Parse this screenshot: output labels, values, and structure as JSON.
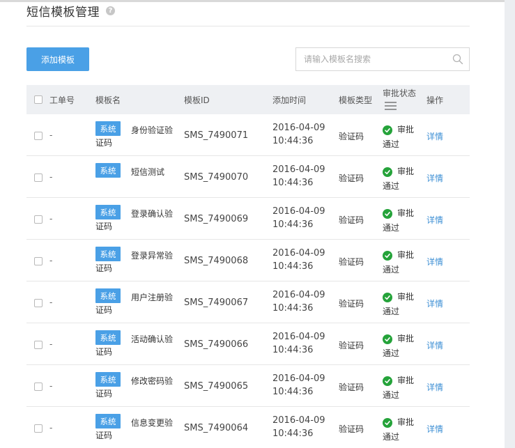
{
  "page": {
    "title": "短信模板管理",
    "help_icon": "question-circle-icon"
  },
  "toolbar": {
    "add_label": "添加模板",
    "search_placeholder": "请输入模板名搜索",
    "search_icon": "search-icon"
  },
  "table": {
    "headers": {
      "order_no": "工单号",
      "name": "模板名",
      "id": "模板ID",
      "added_time": "添加时间",
      "type": "模板类型",
      "status": "审批状态",
      "status_filter_icon": "menu-lines-icon",
      "action": "操作"
    },
    "rows": [
      {
        "order_no": "-",
        "tag": "系统",
        "name": "身份验证验",
        "name_tail": "证码",
        "id": "SMS_7490071",
        "date": "2016-04-09",
        "time": "10:44:36",
        "type": "验证码",
        "status_a": "审批",
        "status_b": "通过",
        "action": "详情"
      },
      {
        "order_no": "-",
        "tag": "系统",
        "name": "短信测试",
        "name_tail": "",
        "id": "SMS_7490070",
        "date": "2016-04-09",
        "time": "10:44:36",
        "type": "验证码",
        "status_a": "审批",
        "status_b": "通过",
        "action": "详情"
      },
      {
        "order_no": "-",
        "tag": "系统",
        "name": "登录确认验",
        "name_tail": "证码",
        "id": "SMS_7490069",
        "date": "2016-04-09",
        "time": "10:44:36",
        "type": "验证码",
        "status_a": "审批",
        "status_b": "通过",
        "action": "详情"
      },
      {
        "order_no": "-",
        "tag": "系统",
        "name": "登录异常验",
        "name_tail": "证码",
        "id": "SMS_7490068",
        "date": "2016-04-09",
        "time": "10:44:36",
        "type": "验证码",
        "status_a": "审批",
        "status_b": "通过",
        "action": "详情"
      },
      {
        "order_no": "-",
        "tag": "系统",
        "name": "用户注册验",
        "name_tail": "证码",
        "id": "SMS_7490067",
        "date": "2016-04-09",
        "time": "10:44:36",
        "type": "验证码",
        "status_a": "审批",
        "status_b": "通过",
        "action": "详情"
      },
      {
        "order_no": "-",
        "tag": "系统",
        "name": "活动确认验",
        "name_tail": "证码",
        "id": "SMS_7490066",
        "date": "2016-04-09",
        "time": "10:44:36",
        "type": "验证码",
        "status_a": "审批",
        "status_b": "通过",
        "action": "详情"
      },
      {
        "order_no": "-",
        "tag": "系统",
        "name": "修改密码验",
        "name_tail": "证码",
        "id": "SMS_7490065",
        "date": "2016-04-09",
        "time": "10:44:36",
        "type": "验证码",
        "status_a": "审批",
        "status_b": "通过",
        "action": "详情"
      },
      {
        "order_no": "-",
        "tag": "系统",
        "name": "信息变更验",
        "name_tail": "证码",
        "id": "SMS_7490064",
        "date": "2016-04-09",
        "time": "10:44:36",
        "type": "验证码",
        "status_a": "审批",
        "status_b": "通过",
        "action": "详情"
      }
    ]
  },
  "colors": {
    "accent": "#4aa0e6",
    "link": "#3d8fd4",
    "success": "#25a33a",
    "header_bg": "#eef0f3"
  }
}
